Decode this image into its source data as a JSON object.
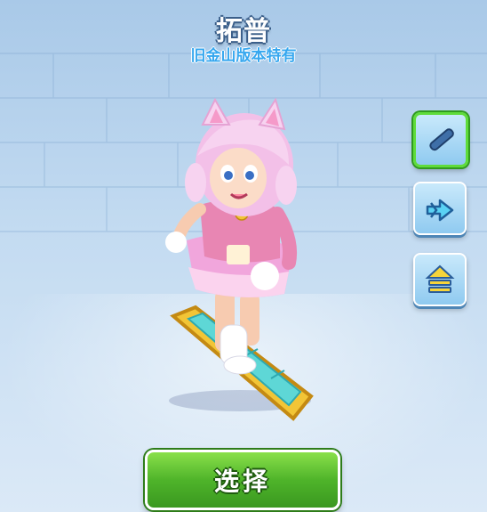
{
  "header": {
    "character_name": "拓普",
    "edition_note": "旧金山版本特有"
  },
  "side_menu": {
    "items": [
      {
        "icon": "hoverboard-icon",
        "selected": true
      },
      {
        "icon": "dash-arrow-icon",
        "selected": false
      },
      {
        "icon": "level-up-icon",
        "selected": false
      }
    ]
  },
  "footer": {
    "select_label": "选择"
  },
  "colors": {
    "select_green": "#4fb42a",
    "subtitle_blue": "#36a7ef",
    "selected_outline": "#5fdc3b"
  }
}
